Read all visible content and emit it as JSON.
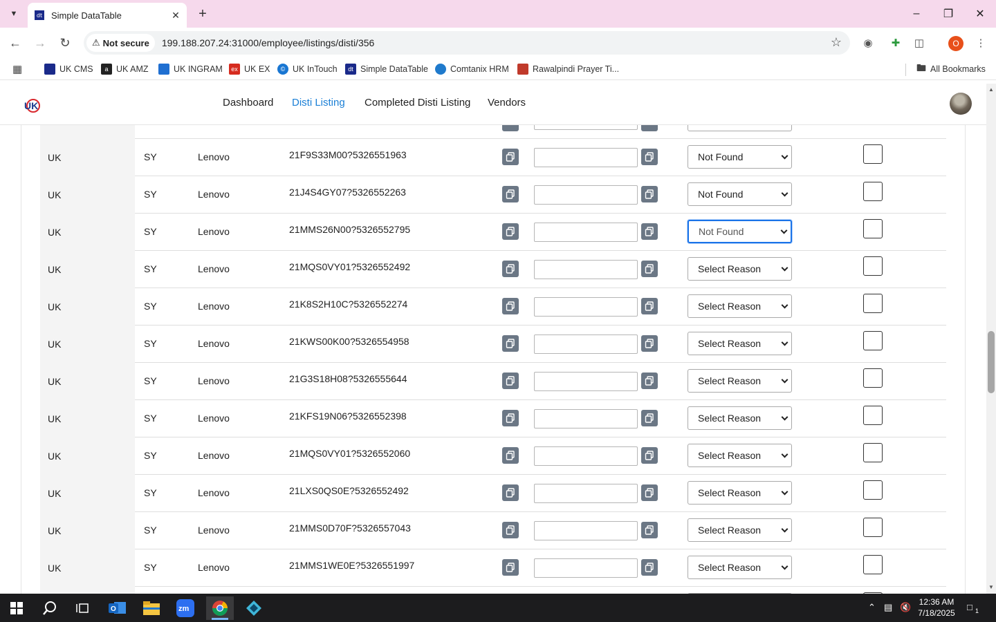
{
  "browser": {
    "tab_title": "Simple DataTable",
    "tab_favicon": "dt",
    "security_label": "Not secure",
    "url": "199.188.207.24:31000/employee/listings/disti/356",
    "profile_initial": "O"
  },
  "bookmarks": [
    {
      "label": "UK CMS",
      "color": "#1a2a8a",
      "glyph": "■"
    },
    {
      "label": "UK AMZ",
      "color": "#222222",
      "glyph": "a"
    },
    {
      "label": "UK INGRAM",
      "color": "#1f6fd1",
      "glyph": "◆"
    },
    {
      "label": "UK EX",
      "color": "#d62b1f",
      "glyph": "ex"
    },
    {
      "label": "UK InTouch",
      "color": "#1976d2",
      "glyph": "©"
    },
    {
      "label": "Simple DataTable",
      "color": "#1a2a8a",
      "glyph": "dt"
    },
    {
      "label": "Comtanix HRM",
      "color": "#1f7acc",
      "glyph": "◆"
    },
    {
      "label": "Rawalpindi Prayer Ti...",
      "color": "#c03a2b",
      "glyph": "▲"
    }
  ],
  "all_bookmarks_label": "All Bookmarks",
  "nav": {
    "items": [
      "Dashboard",
      "Disti Listing",
      "Completed Disti Listing",
      "Vendors"
    ],
    "active": "Disti Listing"
  },
  "rows": [
    {
      "country": "UK",
      "code": "SY",
      "brand": "Lenovo",
      "sku": "21F9S33M00?5326551963",
      "reason": "Not Found"
    },
    {
      "country": "UK",
      "code": "SY",
      "brand": "Lenovo",
      "sku": "21J4S4GY07?5326552263",
      "reason": "Not Found"
    },
    {
      "country": "UK",
      "code": "SY",
      "brand": "Lenovo",
      "sku": "21MMS26N00?5326552795",
      "reason": "Not Found"
    },
    {
      "country": "UK",
      "code": "SY",
      "brand": "Lenovo",
      "sku": "21MQS0VY01?5326552492",
      "reason": "Select Reason"
    },
    {
      "country": "UK",
      "code": "SY",
      "brand": "Lenovo",
      "sku": "21K8S2H10C?5326552274",
      "reason": "Select Reason"
    },
    {
      "country": "UK",
      "code": "SY",
      "brand": "Lenovo",
      "sku": "21KWS00K00?5326554958",
      "reason": "Select Reason"
    },
    {
      "country": "UK",
      "code": "SY",
      "brand": "Lenovo",
      "sku": "21G3S18H08?5326555644",
      "reason": "Select Reason"
    },
    {
      "country": "UK",
      "code": "SY",
      "brand": "Lenovo",
      "sku": "21KFS19N06?5326552398",
      "reason": "Select Reason"
    },
    {
      "country": "UK",
      "code": "SY",
      "brand": "Lenovo",
      "sku": "21MQS0VY01?5326552060",
      "reason": "Select Reason"
    },
    {
      "country": "UK",
      "code": "SY",
      "brand": "Lenovo",
      "sku": "21LXS0QS0E?5326552492",
      "reason": "Select Reason"
    },
    {
      "country": "UK",
      "code": "SY",
      "brand": "Lenovo",
      "sku": "21MMS0D70F?5326557043",
      "reason": "Select Reason"
    },
    {
      "country": "UK",
      "code": "SY",
      "brand": "Lenovo",
      "sku": "21MMS1WE0E?5326551997",
      "reason": "Select Reason"
    }
  ],
  "focused_row": 2,
  "taskbar": {
    "time": "12:36 AM",
    "date": "7/18/2025",
    "notification_count": "1"
  },
  "colors": {
    "tabstrip": "#f6d9ec",
    "nav_active": "#1a7fd6",
    "copy_button": "#6b7785",
    "focus_ring": "#1a73e8"
  }
}
